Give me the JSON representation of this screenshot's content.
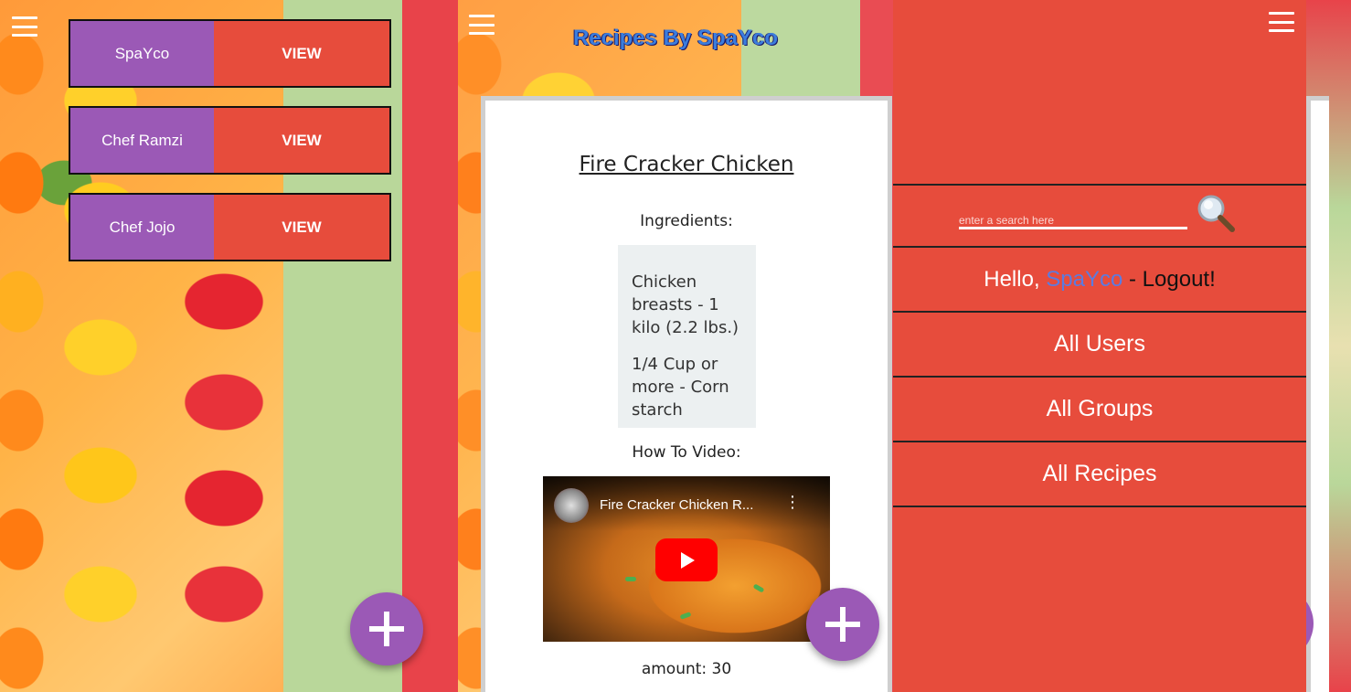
{
  "users_panel": {
    "users": [
      {
        "name": "SpaYco",
        "action": "VIEW"
      },
      {
        "name": "Chef Ramzi",
        "action": "VIEW"
      },
      {
        "name": "Chef Jojo",
        "action": "VIEW"
      }
    ]
  },
  "recipe_panel": {
    "site_title": "Recipes By SpaYco",
    "recipe_name": "Fire Cracker Chicken",
    "ingredients_label": "Ingredients:",
    "ingredients": [
      "Chicken breasts - 1 kilo (2.2 lbs.)",
      "1/4 Cup or more - Corn starch"
    ],
    "video_label": "How To Video:",
    "video_title": "Fire Cracker Chicken R...",
    "amount": "amount: 30"
  },
  "menu_panel": {
    "search_placeholder": "enter a search here",
    "greeting": "Hello,",
    "username": "SpaYco",
    "separator": " - ",
    "logout": "Logout!",
    "nav": [
      "All Users",
      "All Groups",
      "All Recipes"
    ]
  },
  "colors": {
    "accent_red": "#e74c3c",
    "accent_purple": "#9b59b6",
    "link_blue": "#5b7be0"
  },
  "icons": {
    "menu": "hamburger-icon",
    "add": "plus-icon",
    "search": "magnifier-icon",
    "play": "youtube-play-icon"
  }
}
